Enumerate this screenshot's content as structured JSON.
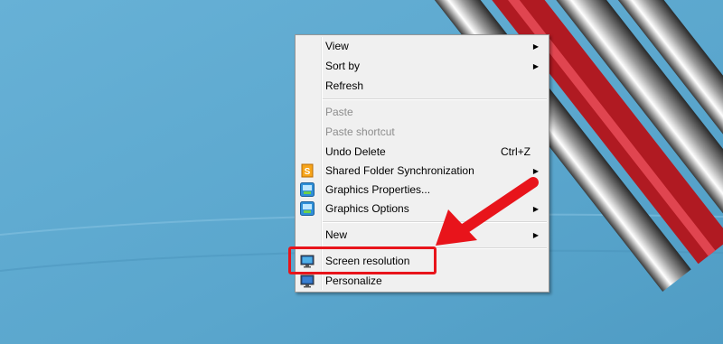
{
  "desktop": {
    "wallpaper_color": "#5ea9cf"
  },
  "context_menu": {
    "items": [
      {
        "label": "View",
        "submenu": true
      },
      {
        "label": "Sort by",
        "submenu": true
      },
      {
        "label": "Refresh"
      },
      {
        "label": "Paste",
        "disabled": true
      },
      {
        "label": "Paste shortcut",
        "disabled": true
      },
      {
        "label": "Undo Delete",
        "shortcut": "Ctrl+Z"
      },
      {
        "label": "Shared Folder Synchronization",
        "submenu": true,
        "icon": "sync-icon"
      },
      {
        "label": "Graphics Properties...",
        "icon": "graphics-icon"
      },
      {
        "label": "Graphics Options",
        "submenu": true,
        "icon": "graphics-icon"
      },
      {
        "label": "New",
        "submenu": true
      },
      {
        "label": "Screen resolution",
        "icon": "monitor-icon",
        "highlighted": true
      },
      {
        "label": "Personalize",
        "icon": "monitor-icon"
      }
    ],
    "submenu_arrow": "▶"
  },
  "annotation": {
    "color": "#e8141b",
    "target": "Screen resolution"
  }
}
